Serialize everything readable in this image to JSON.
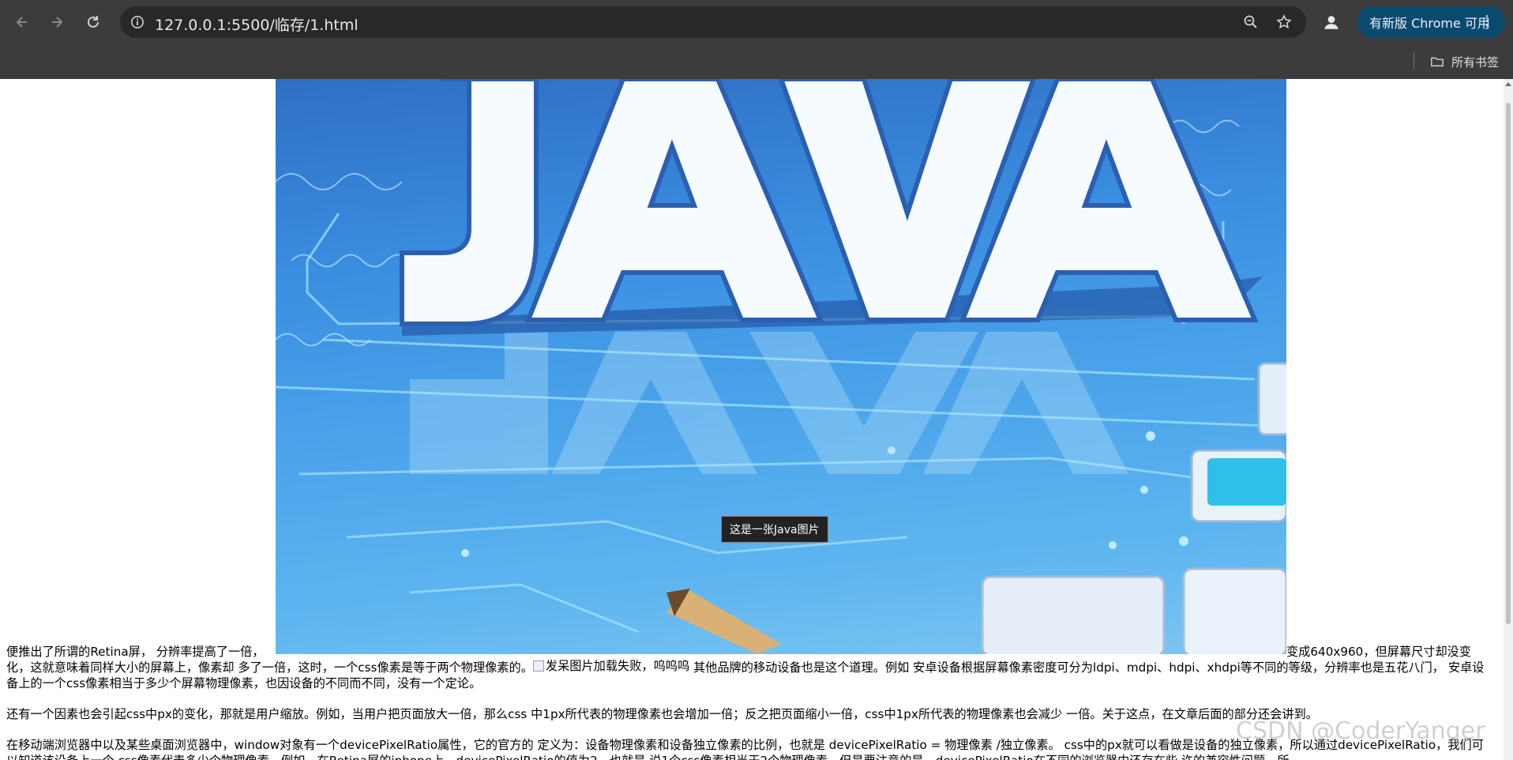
{
  "browser": {
    "url": "127.0.0.1:5500/临存/1.html",
    "update_label": "有新版 Chrome 可用",
    "bookmarks_all": "所有书签",
    "colors": {
      "toolbar": "#3c3c3c",
      "omnibox": "#282828",
      "update": "#0b4a6f"
    }
  },
  "page": {
    "image_alt": "这是一张Java图片",
    "image_word": "JAVA",
    "tooltip": "这是一张Java图片",
    "line1_left": "便推出了所谓的Retina屏， 分辨率提高了一倍，",
    "line1_right": "变成640x960，但屏幕尺寸却没变",
    "para1_a": "化，这就意味着同样大小的屏幕上，像素却 多了一倍，这时，一个css像素是等于两个物理像素的。",
    "broken_image_alt": "发呆图片加载失败，呜呜呜",
    "para1_b": " 其他品牌的移动设备也是这个道理。例如 安卓设备根据屏幕像素密度可分为ldpi、mdpi、hdpi、xhdpi等不同的等级，分辨率也是五花八门， 安卓设备上的一个css像素相当于多少个屏幕物理像素，也因设备的不同而不同，没有一个定论。",
    "para2": "还有一个因素也会引起css中px的变化，那就是用户缩放。例如，当用户把页面放大一倍，那么css 中1px所代表的物理像素也会增加一倍；反之把页面缩小一倍，css中1px所代表的物理像素也会减少 一倍。关于这点，在文章后面的部分还会讲到。",
    "para3": "在移动端浏览器中以及某些桌面浏览器中，window对象有一个devicePixelRatio属性，它的官方的 定义为：设备物理像素和设备独立像素的比例，也就是 devicePixelRatio = 物理像素 /独立像素。 css中的px就可以看做是设备的独立像素，所以通过devicePixelRatio，我们可以知道该设备上一个 css像素代表多少个物理像素。例如，在Retina屏的iphone上，devicePixelRatio的值为2，也就是 说1个css像素相当于2个物理像素。但是要注意的是，devicePixelRatio在不同的浏览器中还存在些 许的兼容性问题，所"
  },
  "watermark": "CSDN @CoderYanger"
}
